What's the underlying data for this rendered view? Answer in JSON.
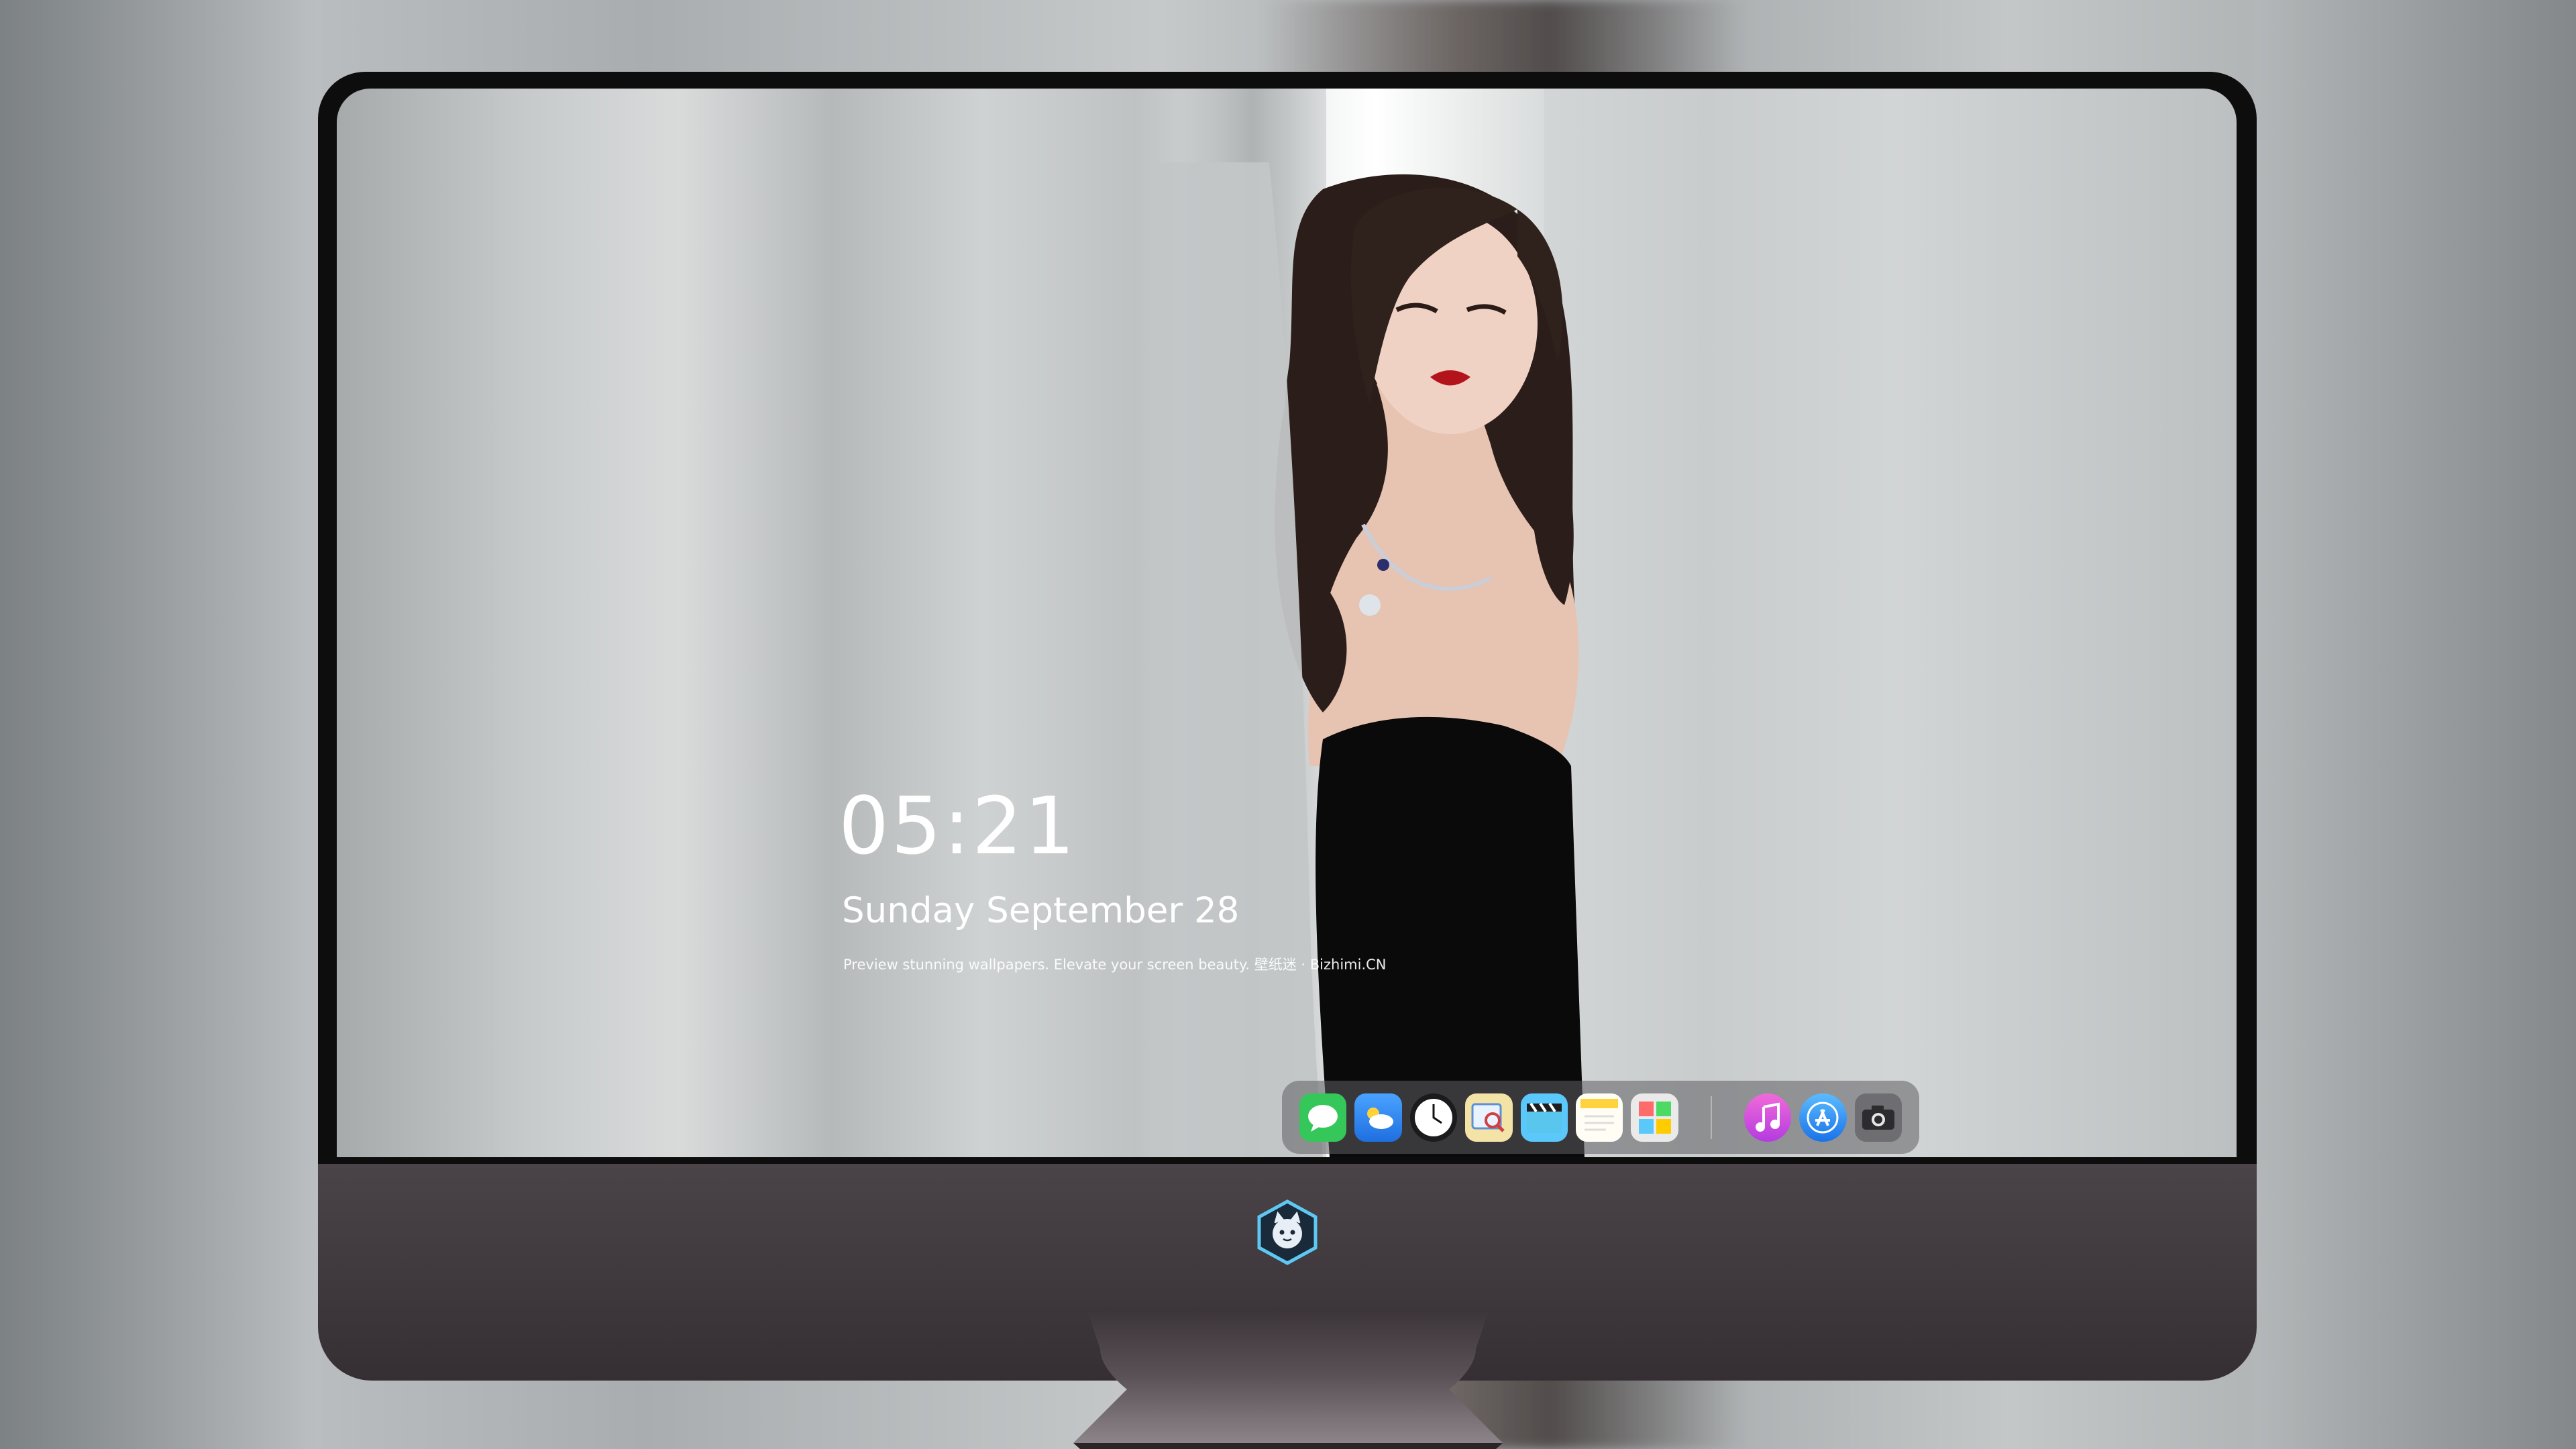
{
  "lock_screen": {
    "time": "05:21",
    "date": "Sunday September  28",
    "caption": "Preview stunning wallpapers. Elevate your screen beauty. 壁纸迷 · Bizhimi.CN"
  },
  "dock": {
    "items": [
      {
        "name": "messages",
        "icon": "chat-bubble-icon",
        "color": "#35c759"
      },
      {
        "name": "weather",
        "icon": "cloud-sun-icon",
        "color": "#3a8ef5"
      },
      {
        "name": "clock",
        "icon": "clock-icon",
        "color": "#ffffff"
      },
      {
        "name": "preview",
        "icon": "magnifier-photo-icon",
        "color": "#f2d36b"
      },
      {
        "name": "video",
        "icon": "clapperboard-icon",
        "color": "#5ac8fa"
      },
      {
        "name": "notes",
        "icon": "notepad-icon",
        "color": "#ffd33d"
      },
      {
        "name": "photo-booth",
        "icon": "photo-grid-icon",
        "color": "#e9e9e9"
      },
      {
        "name": "itunes",
        "icon": "music-note-icon",
        "color": "#d94bd2"
      },
      {
        "name": "app-store",
        "icon": "app-store-icon",
        "color": "#2b8ff0"
      },
      {
        "name": "camera",
        "icon": "camera-icon",
        "color": "#3a3a3c"
      }
    ]
  },
  "brand": {
    "logo": "cat-mascot-hexagon-logo",
    "accent": "#5ec8f2"
  },
  "colors": {
    "bezel": "#0d0d0e",
    "chin": "#3e383d",
    "dock_bg": "#5f5f62"
  }
}
